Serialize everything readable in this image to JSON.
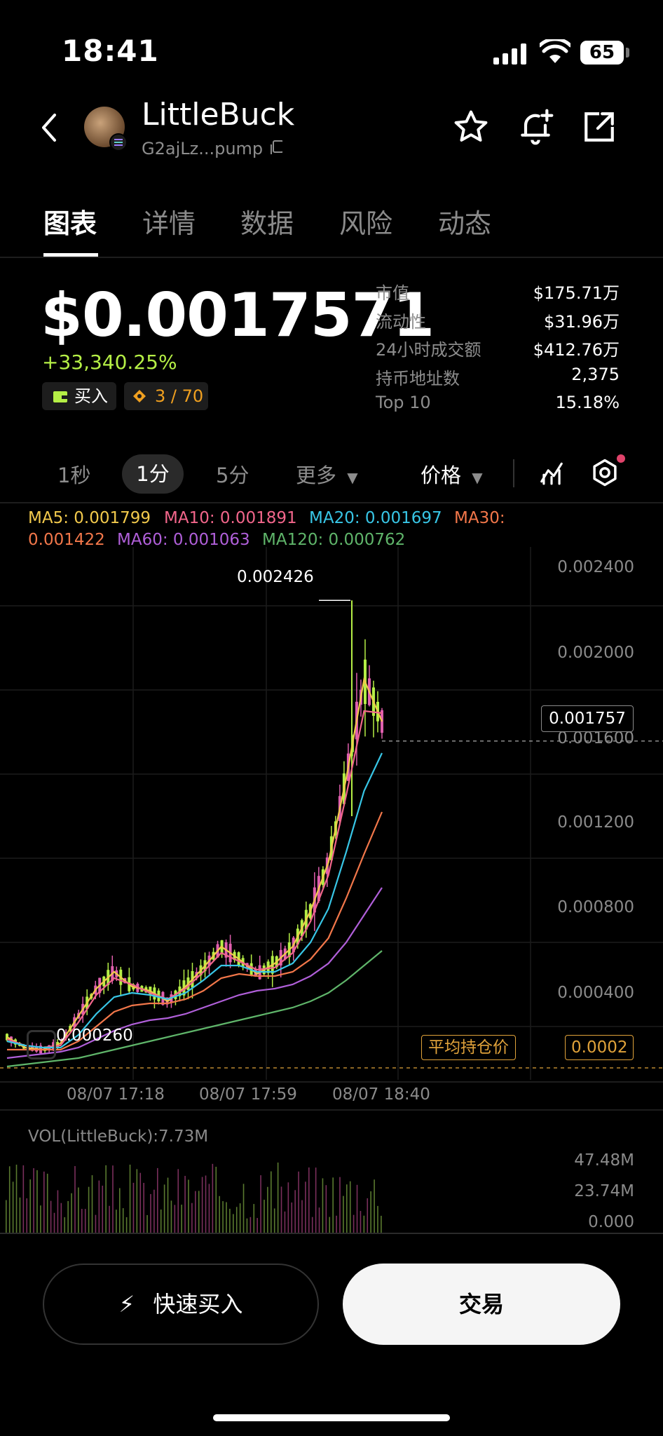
{
  "status_bar": {
    "time": "18:41",
    "battery": "65"
  },
  "header": {
    "token_name": "LittleBuck",
    "token_address": "G2ajLz...pump"
  },
  "tabs": [
    {
      "label": "图表"
    },
    {
      "label": "详情"
    },
    {
      "label": "数据"
    },
    {
      "label": "风险"
    },
    {
      "label": "动态"
    }
  ],
  "price": {
    "value": "$0.0017571",
    "change": "+33,340.25%"
  },
  "chips": {
    "buy_label": "买入",
    "ratio": "3 / 70"
  },
  "stats": [
    {
      "label": "市值",
      "value": "$175.71万"
    },
    {
      "label": "流动性",
      "value": "$31.96万"
    },
    {
      "label": "24小时成交额",
      "value": "$412.76万"
    },
    {
      "label": "持币地址数",
      "value": "2,375"
    },
    {
      "label": "Top 10",
      "value": "15.18%"
    }
  ],
  "timeframes": {
    "t1": "1秒",
    "t2": "1分",
    "t3": "5分",
    "more": "更多",
    "price_type": "价格"
  },
  "ma_legend": {
    "ma5": "MA5: 0.001799",
    "ma10": "MA10: 0.001891",
    "ma20": "MA20: 0.001697",
    "ma30_label": "MA30:",
    "ma30_value": "0.001422",
    "ma60": "MA60: 0.001063",
    "ma120": "MA120: 0.000762"
  },
  "colors": {
    "ma5": "#f2c94c",
    "ma10": "#f2668b",
    "ma20": "#38c6e6",
    "ma30": "#f2774a",
    "ma60": "#b05fd9",
    "ma120": "#5fb56a",
    "up": "#b5ef46",
    "down": "#e05fae",
    "avg": "#e0a23a"
  },
  "chart_data": {
    "type": "line",
    "title": "",
    "y_ticks": [
      "0.002400",
      "0.002000",
      "0.001600",
      "0.001200",
      "0.000800",
      "0.000400"
    ],
    "x_ticks": [
      "08/07 17:18",
      "08/07 17:59",
      "08/07 18:40"
    ],
    "high_label": "0.002426",
    "low_label": "0.000260",
    "current_price": "0.001757",
    "avg_cost_label": "平均持仓价",
    "avg_cost_value": "0.0002",
    "ylim": [
      0.0002,
      0.0026
    ],
    "series": [
      {
        "name": "MA5",
        "values": [
          0.00035,
          0.0003,
          0.00029,
          0.00032,
          0.00045,
          0.00058,
          0.00066,
          0.00059,
          0.00057,
          0.00052,
          0.00059,
          0.00068,
          0.00078,
          0.00072,
          0.00065,
          0.0007,
          0.00078,
          0.00095,
          0.00118,
          0.00158,
          0.00205,
          0.00185
        ]
      },
      {
        "name": "MA10",
        "values": [
          0.00034,
          0.00031,
          0.0003,
          0.00031,
          0.00042,
          0.00055,
          0.00063,
          0.0006,
          0.00056,
          0.00053,
          0.00058,
          0.00066,
          0.00075,
          0.00071,
          0.00067,
          0.00068,
          0.00075,
          0.0009,
          0.00112,
          0.0015,
          0.0019,
          0.00189
        ]
      },
      {
        "name": "MA20",
        "values": [
          0.00033,
          0.00031,
          0.0003,
          0.0003,
          0.00036,
          0.00046,
          0.00054,
          0.00056,
          0.00055,
          0.00053,
          0.00056,
          0.00062,
          0.00069,
          0.00069,
          0.00066,
          0.00066,
          0.0007,
          0.0008,
          0.00096,
          0.00123,
          0.00152,
          0.0017
        ]
      },
      {
        "name": "MA30",
        "values": [
          0.00029,
          0.00029,
          0.00029,
          0.00029,
          0.00033,
          0.0004,
          0.00047,
          0.0005,
          0.00051,
          0.00051,
          0.00053,
          0.00057,
          0.00063,
          0.00065,
          0.00064,
          0.00064,
          0.00066,
          0.00072,
          0.00082,
          0.00101,
          0.00122,
          0.00142
        ]
      },
      {
        "name": "MA60",
        "values": [
          0.00025,
          0.00026,
          0.00027,
          0.00028,
          0.0003,
          0.00034,
          0.00038,
          0.00041,
          0.00043,
          0.00044,
          0.00046,
          0.00049,
          0.00052,
          0.00055,
          0.00057,
          0.00058,
          0.0006,
          0.00064,
          0.0007,
          0.0008,
          0.00093,
          0.00106
        ]
      },
      {
        "name": "MA120",
        "values": [
          0.00021,
          0.00022,
          0.00023,
          0.00024,
          0.00025,
          0.00027,
          0.00029,
          0.00031,
          0.00033,
          0.00035,
          0.00037,
          0.00039,
          0.00041,
          0.00043,
          0.00045,
          0.00047,
          0.00049,
          0.00052,
          0.00056,
          0.00062,
          0.00069,
          0.00076
        ]
      }
    ]
  },
  "volume": {
    "title": "VOL(LittleBuck):7.73M",
    "ticks": [
      "47.48M",
      "23.74M",
      "0.000"
    ]
  },
  "actions": {
    "quick_buy": "快速买入",
    "trade": "交易"
  }
}
